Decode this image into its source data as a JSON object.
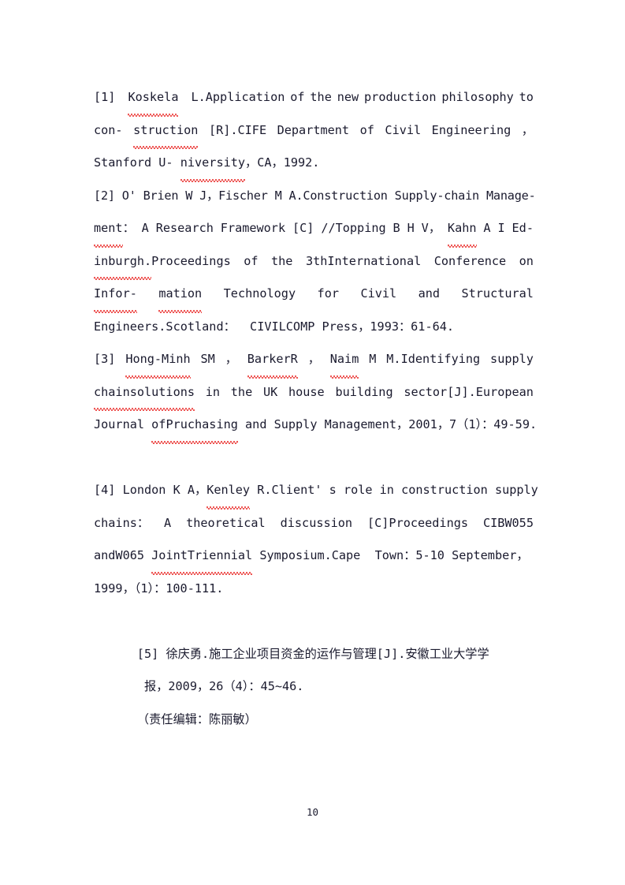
{
  "document": {
    "page_number": "10",
    "text_color": "#1a1a2e",
    "spellcheck_color": "#e8201e",
    "background": "#ffffff"
  },
  "references": [
    {
      "marker": "[1]",
      "lines": [
        {
          "segments": [
            {
              "t": "[1] ",
              "sq": false
            },
            {
              "t": "Koskela",
              "sq": true
            },
            {
              "t": " L.Application",
              "sq": false
            },
            {
              "t": "of",
              "sq": false
            },
            {
              "t": "the",
              "sq": false
            },
            {
              "t": "new",
              "sq": false
            },
            {
              "t": "production",
              "sq": false
            },
            {
              "t": "philosophy",
              "sq": false
            },
            {
              "t": "to",
              "sq": false
            }
          ]
        },
        {
          "segments": [
            {
              "t": "con-",
              "sq": false
            },
            {
              "t": "struction",
              "sq": true
            },
            {
              "t": "[R].CIFE",
              "sq": false
            },
            {
              "t": "Department",
              "sq": false
            },
            {
              "t": "of",
              "sq": false
            },
            {
              "t": "Civil",
              "sq": false
            },
            {
              "t": "Engineering",
              "sq": false
            },
            {
              "t": "，",
              "sq": false
            }
          ]
        },
        {
          "segments": [
            {
              "t": "Stanford U- ",
              "sq": false
            },
            {
              "t": "niversity",
              "sq": true
            },
            {
              "t": "，CA，1992.",
              "sq": false
            }
          ]
        }
      ]
    },
    {
      "marker": "[2]",
      "lines": [
        {
          "segments": [
            {
              "t": "[2] O' Brien W J，Fischer M A.Construction Supply-chain Manage-",
              "sq": false
            }
          ]
        },
        {
          "segments": [
            {
              "t": "ment",
              "sq": true
            },
            {
              "t": "：",
              "sq": false
            },
            {
              "t": "A",
              "sq": false
            },
            {
              "t": "Research",
              "sq": false
            },
            {
              "t": "Framework",
              "sq": false
            },
            {
              "t": "[C]",
              "sq": false
            },
            {
              "t": "//Topping",
              "sq": false
            },
            {
              "t": "B",
              "sq": false
            },
            {
              "t": "H",
              "sq": false
            },
            {
              "t": "V，",
              "sq": false
            },
            {
              "t": "Kahn",
              "sq": true
            },
            {
              "t": "A",
              "sq": false
            },
            {
              "t": "I",
              "sq": false
            },
            {
              "t": "Ed-",
              "sq": false
            }
          ]
        },
        {
          "segments": [
            {
              "t": "inburgh.",
              "sq": true
            },
            {
              "t": "Proceedings",
              "sq": false
            },
            {
              "t": "of",
              "sq": false
            },
            {
              "t": "the",
              "sq": false
            },
            {
              "t": "3thInternational",
              "sq": false
            },
            {
              "t": "Conference",
              "sq": false
            },
            {
              "t": "on",
              "sq": false
            }
          ]
        },
        {
          "segments": [
            {
              "t": "Infor-",
              "sq": true
            },
            {
              "t": "mation",
              "sq": true
            },
            {
              "t": "Technology",
              "sq": false
            },
            {
              "t": "for",
              "sq": false
            },
            {
              "t": "Civil",
              "sq": false
            },
            {
              "t": "and",
              "sq": false
            },
            {
              "t": "Structural",
              "sq": false
            }
          ]
        },
        {
          "segments": [
            {
              "t": "Engineers.Scotland：  CIVILCOMP Press，1993：61-64.",
              "sq": false
            }
          ]
        }
      ]
    },
    {
      "marker": "[3]",
      "lines": [
        {
          "segments": [
            {
              "t": "[3]",
              "sq": false
            },
            {
              "t": "Hong-Minh",
              "sq": true
            },
            {
              "t": "SM",
              "sq": false
            },
            {
              "t": "，",
              "sq": false
            },
            {
              "t": "BarkerR",
              "sq": true
            },
            {
              "t": "，",
              "sq": false
            },
            {
              "t": "Naim",
              "sq": true
            },
            {
              "t": "M",
              "sq": false
            },
            {
              "t": "M.Identifying",
              "sq": false
            },
            {
              "t": "supply",
              "sq": false
            }
          ]
        },
        {
          "segments": [
            {
              "t": "chainsolutions",
              "sq": true
            },
            {
              "t": "in",
              "sq": false
            },
            {
              "t": "the",
              "sq": false
            },
            {
              "t": "UK",
              "sq": false
            },
            {
              "t": "house",
              "sq": false
            },
            {
              "t": "building",
              "sq": false
            },
            {
              "t": "sector[J].European",
              "sq": false
            }
          ]
        },
        {
          "segments": [
            {
              "t": "Journal ",
              "sq": false
            },
            {
              "t": "ofPruchasing",
              "sq": true
            },
            {
              "t": " and Supply Management，2001，7（1）：49-59.",
              "sq": false
            }
          ]
        }
      ]
    },
    {
      "marker": "[4]",
      "lines": [
        {
          "segments": [
            {
              "t": "[4] London K A，",
              "sq": false
            },
            {
              "t": "Kenley",
              "sq": true
            },
            {
              "t": " R.Client' s role in construction supply",
              "sq": false
            }
          ]
        },
        {
          "segments": [
            {
              "t": "chains：",
              "sq": false
            },
            {
              "t": "A",
              "sq": false
            },
            {
              "t": "theoretical",
              "sq": false
            },
            {
              "t": "discussion",
              "sq": false
            },
            {
              "t": "[C]Proceedings",
              "sq": false
            },
            {
              "t": "CIBW055",
              "sq": false
            }
          ]
        },
        {
          "segments": [
            {
              "t": "andW065 ",
              "sq": false
            },
            {
              "t": "JointTriennial",
              "sq": true
            },
            {
              "t": " Symposium.Cape  Town：5-10 September，",
              "sq": false
            }
          ]
        },
        {
          "segments": [
            {
              "t": "1999，（1）：100-111.",
              "sq": false
            }
          ]
        }
      ]
    },
    {
      "marker": "[5]",
      "lines": [
        {
          "segments": [
            {
              "t": "[5] 徐庆勇.施工企业项目资金的运作与管理[J].安徽工业大学学",
              "sq": false
            }
          ]
        },
        {
          "segments": [
            {
              "t": " 报，2009，26（4）：45~46.",
              "sq": false
            }
          ]
        }
      ]
    }
  ],
  "editor_note": "（责任编辑：陈丽敏）"
}
